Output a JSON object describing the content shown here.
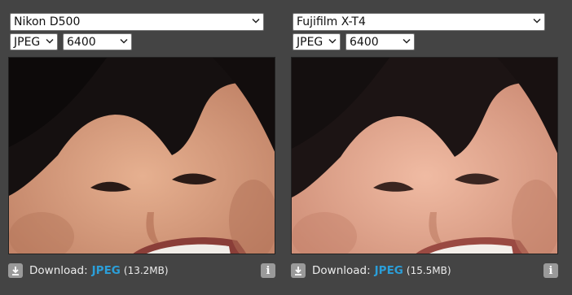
{
  "panels": [
    {
      "camera": "Nikon D500",
      "format": "JPEG",
      "iso": "6400",
      "photo_icon": "portrait-crop",
      "download_label": "Download:",
      "download_link": "JPEG",
      "download_size": "(13.2MB)"
    },
    {
      "camera": "Fujifilm X-T4",
      "format": "JPEG",
      "iso": "6400",
      "photo_icon": "portrait-crop",
      "download_label": "Download:",
      "download_link": "JPEG",
      "download_size": "(15.5MB)"
    }
  ],
  "colors": {
    "background": "#444444",
    "link": "#2b9fd9",
    "icon_bg": "#9a9a9a"
  }
}
